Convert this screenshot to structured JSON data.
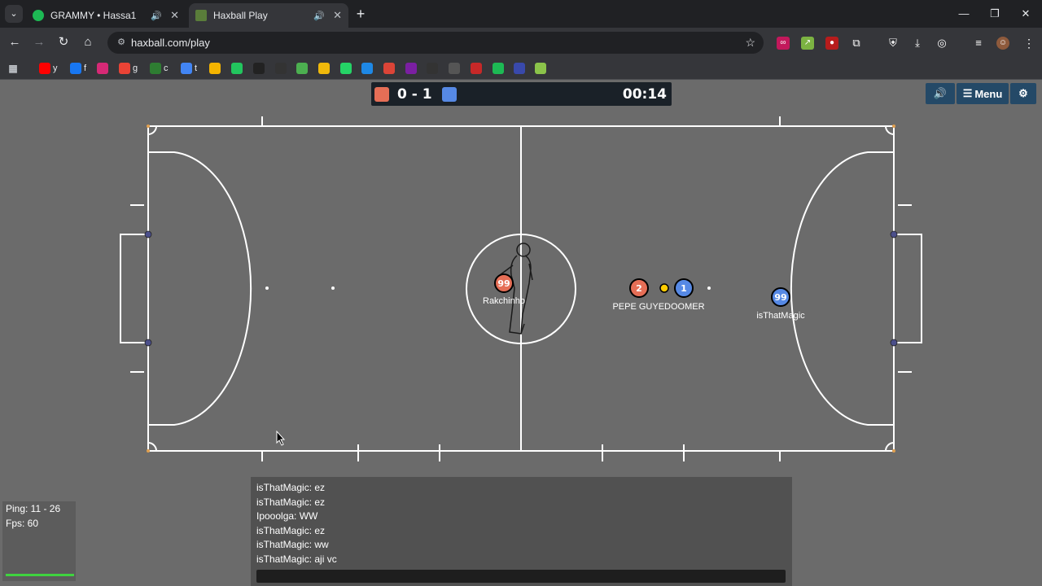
{
  "browser": {
    "tabs": [
      {
        "title": "GRAMMY • Hassa1",
        "icon": "spotify-icon",
        "active": false
      },
      {
        "title": "Haxball Play",
        "icon": "haxball-icon",
        "active": true
      }
    ],
    "url": "haxball.com/play"
  },
  "bookmarks": [
    {
      "icon": "youtube-icon",
      "label": "y",
      "color": "#ff0000"
    },
    {
      "icon": "facebook-icon",
      "label": "f",
      "color": "#1877f2"
    },
    {
      "icon": "instagram-icon",
      "label": "",
      "color": "#d62976"
    },
    {
      "icon": "gmail-icon",
      "label": "g",
      "color": "#ea4335"
    },
    {
      "icon": "l-icon",
      "label": "c",
      "color": "#2e7d32"
    },
    {
      "icon": "translate-icon",
      "label": "t",
      "color": "#4285f4"
    },
    {
      "icon": "folder-icon",
      "label": "",
      "color": "#f4b400"
    },
    {
      "icon": "k-icon",
      "label": "",
      "color": "#22c55e"
    },
    {
      "icon": "circle-app-icon",
      "label": "",
      "color": "#222222"
    },
    {
      "icon": "b-app-icon",
      "label": "",
      "color": "#333333"
    },
    {
      "icon": "leaf-icon",
      "label": "",
      "color": "#4caf50"
    },
    {
      "icon": "binance-icon",
      "label": "",
      "color": "#f0b90b"
    },
    {
      "icon": "whatsapp-icon",
      "label": "",
      "color": "#25d366"
    },
    {
      "icon": "play-app-icon",
      "label": "",
      "color": "#1e88e5"
    },
    {
      "icon": "chrome-icon",
      "label": "",
      "color": "#db4437"
    },
    {
      "icon": "purple-app-icon",
      "label": "",
      "color": "#7b1fa2"
    },
    {
      "icon": "dark-app-icon",
      "label": "",
      "color": "#333333"
    },
    {
      "icon": "camera-app-icon",
      "label": "",
      "color": "#555555"
    },
    {
      "icon": "football-icon",
      "label": "",
      "color": "#c62828"
    },
    {
      "icon": "spotify-icon",
      "label": "",
      "color": "#1db954"
    },
    {
      "icon": "x-app-icon",
      "label": "",
      "color": "#3949ab"
    },
    {
      "icon": "chart-app-icon",
      "label": "",
      "color": "#8bc34a"
    }
  ],
  "scoreboard": {
    "red_color": "#e56e56",
    "blue_color": "#5689e5",
    "score": "0 - 1",
    "time": "00:14"
  },
  "menu": {
    "label": "Menu"
  },
  "players": [
    {
      "number": "99",
      "name": "Rakchinho",
      "team": "red"
    },
    {
      "number": "2",
      "name": "",
      "team": "red"
    },
    {
      "number": "1",
      "name": "",
      "team": "blue"
    },
    {
      "number": "99",
      "name": "isThatMagic",
      "team": "blue"
    }
  ],
  "player_labels": {
    "pair": "PEPE GUYEDOOMER"
  },
  "stats": {
    "ping": "Ping: 11 - 26",
    "fps": "Fps: 60"
  },
  "chat": {
    "messages": [
      "isThatMagic: ez",
      "isThatMagic: ez",
      "Ipooolga: WW",
      "isThatMagic: ez",
      "isThatMagic: ww",
      "isThatMagic: aji vc"
    ]
  }
}
